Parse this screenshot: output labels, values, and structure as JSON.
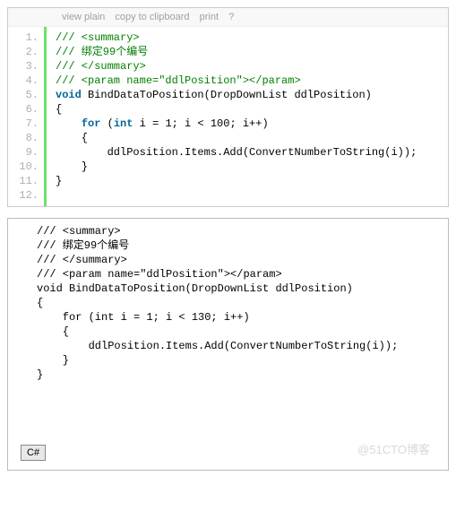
{
  "toolbar": {
    "viewplain": "view plain",
    "copy": "copy to clipboard",
    "print": "print",
    "help": "?"
  },
  "block1": {
    "line_count": 12,
    "code": {
      "l1": "/// <summary>",
      "l2": "/// 绑定99个编号",
      "l3": "/// </summary>",
      "l4_a": "/// <param name=\"ddlPosition\"></param>",
      "l5_kw_void": "void",
      "l5_rest": " BindDataToPosition(DropDownList ddlPosition)",
      "l6": "{",
      "l7_a": "    ",
      "l7_for": "for",
      "l7_b": " (",
      "l7_int": "int",
      "l7_c": " i = 1; i < 100; i++)",
      "l8": "    {",
      "l9": "        ddlPosition.Items.Add(ConvertNumberToString(i));",
      "l10": "    }",
      "l11": "}",
      "l12": " "
    }
  },
  "block2": {
    "lines": [
      "/// <summary>",
      "/// 绑定99个编号",
      "/// </summary>",
      "/// <param name=\"ddlPosition\"></param>",
      "void BindDataToPosition(DropDownList ddlPosition)",
      "{",
      "    for (int i = 1; i < 130; i++)",
      "    {",
      "        ddlPosition.Items.Add(ConvertNumberToString(i));",
      "    }",
      "}"
    ]
  },
  "tag": {
    "label": "C#"
  },
  "watermark": "@51CTO博客"
}
